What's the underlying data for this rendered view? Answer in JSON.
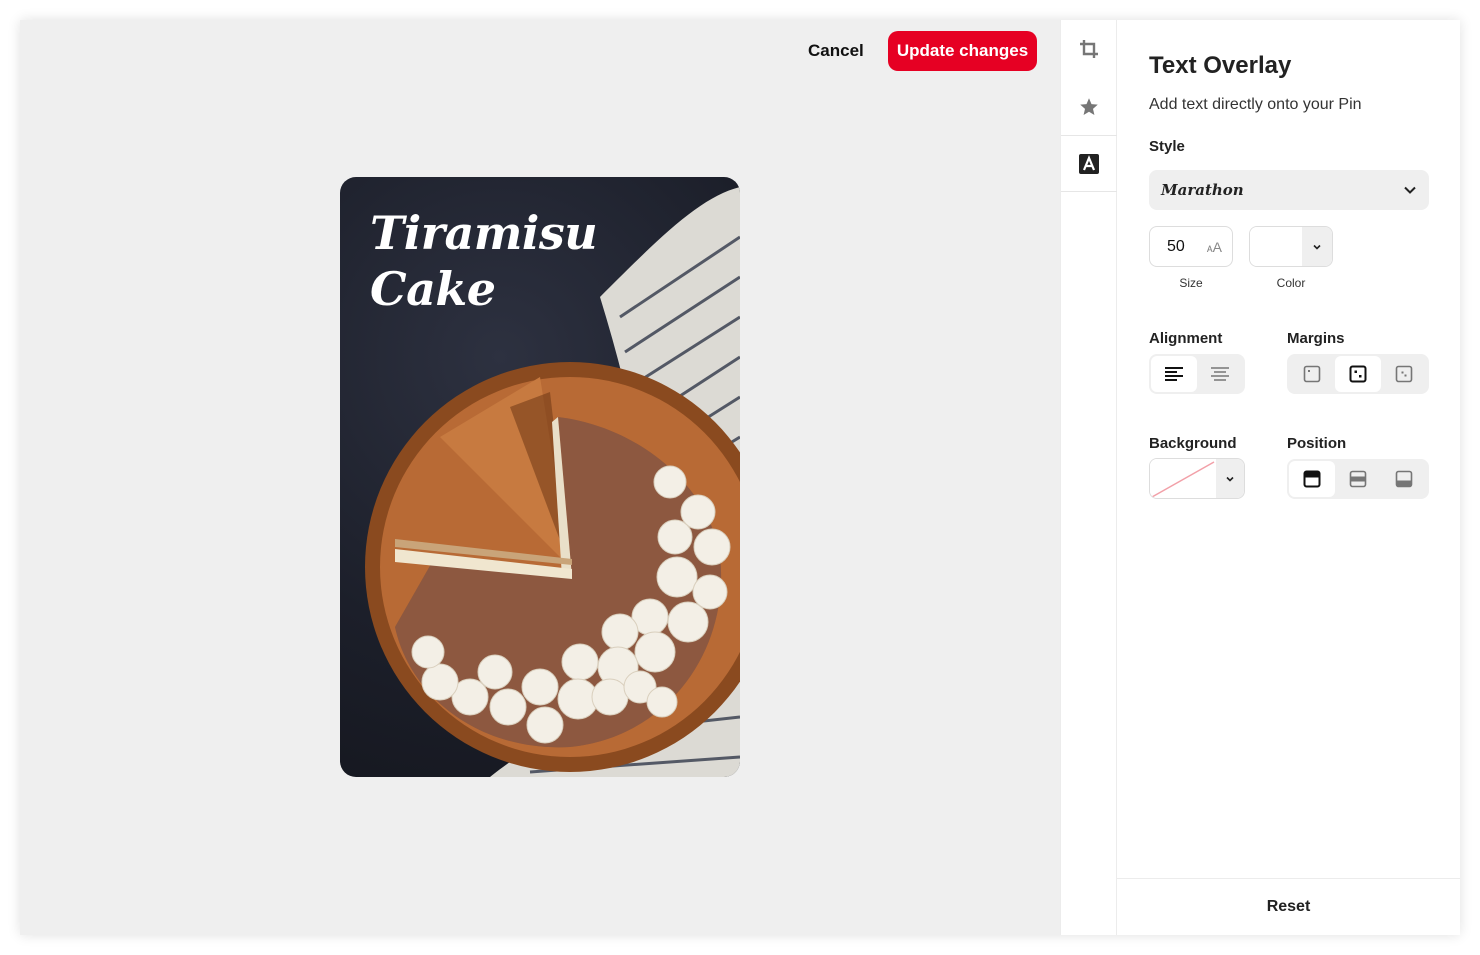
{
  "header": {
    "cancel_label": "Cancel",
    "update_label": "Update changes"
  },
  "pin": {
    "title_line1": "Tiramisu",
    "title_line2": "Cake"
  },
  "rail": {
    "icons": [
      "crop-icon",
      "star-icon",
      "text-overlay-icon"
    ],
    "active": "text-overlay-icon"
  },
  "panel": {
    "title": "Text Overlay",
    "subtitle": "Add text directly onto your Pin",
    "style_label": "Style",
    "style_value": "Marathon",
    "size_value": "50",
    "size_label": "Size",
    "color_label": "Color",
    "alignment_label": "Alignment",
    "alignment_selected": "left",
    "margins_label": "Margins",
    "margins_selected": "medium",
    "background_label": "Background",
    "position_label": "Position",
    "position_selected": "top",
    "reset_label": "Reset"
  },
  "colors": {
    "accent": "#e60023",
    "canvas_bg": "#efefef"
  }
}
